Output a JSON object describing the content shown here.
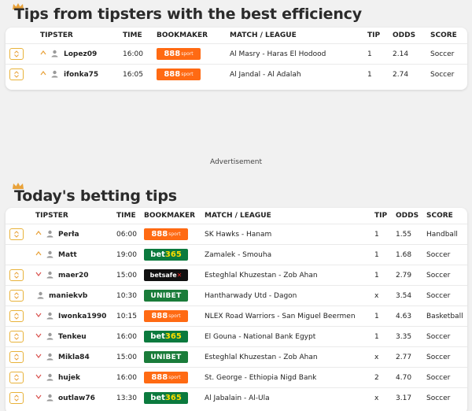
{
  "section1": {
    "title": "Tips from tipsters with the best efficiency",
    "headers": {
      "tipster": "TIPSTER",
      "time": "TIME",
      "bookmaker": "BOOKMAKER",
      "match": "MATCH / LEAGUE",
      "tip": "TIP",
      "odds": "ODDS",
      "score": "SCORE"
    },
    "rows": [
      {
        "tipster": "Lopez09",
        "trend": "up",
        "time": "16:00",
        "bookmaker": "888sport",
        "match": "Al Masry - Haras El Hodood",
        "tip": "1",
        "odds": "2.14",
        "score": "Soccer",
        "expand": true
      },
      {
        "tipster": "ifonka75",
        "trend": "up",
        "time": "16:05",
        "bookmaker": "888sport",
        "match": "Al Jandal - Al Adalah",
        "tip": "1",
        "odds": "2.74",
        "score": "Soccer",
        "expand": true
      }
    ]
  },
  "advertisement": "Advertisement",
  "section2": {
    "title": "Today's betting tips",
    "headers": {
      "tipster": "TIPSTER",
      "time": "TIME",
      "bookmaker": "BOOKMAKER",
      "match": "MATCH / LEAGUE",
      "tip": "TIP",
      "odds": "ODDS",
      "score": "SCORE"
    },
    "rows": [
      {
        "tipster": "Perła",
        "trend": "up",
        "time": "06:00",
        "bookmaker": "888sport",
        "match": "SK Hawks - Hanam",
        "tip": "1",
        "odds": "1.55",
        "score": "Handball",
        "expand": true
      },
      {
        "tipster": "Matt",
        "trend": "up",
        "time": "19:00",
        "bookmaker": "bet365",
        "match": "Zamalek - Smouha",
        "tip": "1",
        "odds": "1.68",
        "score": "Soccer",
        "expand": false
      },
      {
        "tipster": "maer20",
        "trend": "down",
        "time": "15:00",
        "bookmaker": "betsafe",
        "match": "Esteghlal Khuzestan - Zob Ahan",
        "tip": "1",
        "odds": "2.79",
        "score": "Soccer",
        "expand": true
      },
      {
        "tipster": "maniekvb",
        "trend": "none",
        "time": "10:30",
        "bookmaker": "UNIBET",
        "match": "Hantharwady Utd - Dagon",
        "tip": "x",
        "odds": "3.54",
        "score": "Soccer",
        "expand": true
      },
      {
        "tipster": "Iwonka1990",
        "trend": "down",
        "time": "10:15",
        "bookmaker": "888sport",
        "match": "NLEX Road Warriors - San Miguel Beermen",
        "tip": "1",
        "odds": "4.63",
        "score": "Basketball",
        "expand": true
      },
      {
        "tipster": "Tenkeu",
        "trend": "down",
        "time": "16:00",
        "bookmaker": "bet365",
        "match": "El Gouna - National Bank Egypt",
        "tip": "1",
        "odds": "3.35",
        "score": "Soccer",
        "expand": true
      },
      {
        "tipster": "Mikla84",
        "trend": "down",
        "time": "15:00",
        "bookmaker": "UNIBET",
        "match": "Esteghlal Khuzestan - Zob Ahan",
        "tip": "x",
        "odds": "2.77",
        "score": "Soccer",
        "expand": true
      },
      {
        "tipster": "hujek",
        "trend": "down",
        "time": "16:00",
        "bookmaker": "888sport",
        "match": "St. George - Ethiopia Nigd Bank",
        "tip": "2",
        "odds": "4.70",
        "score": "Soccer",
        "expand": true
      },
      {
        "tipster": "outlaw76",
        "trend": "down",
        "time": "13:30",
        "bookmaker": "bet365",
        "match": "Al Jabalain - Al-Ula",
        "tip": "x",
        "odds": "3.17",
        "score": "Soccer",
        "expand": true
      }
    ]
  },
  "colors": {
    "accent": "#e8b23a",
    "up": "#e8a23a",
    "down": "#d9534f",
    "brand_888": "#ff6a13",
    "brand_bet365": "#0b7a3e",
    "brand_unibet": "#1a7c3a",
    "brand_betsafe": "#111111"
  }
}
